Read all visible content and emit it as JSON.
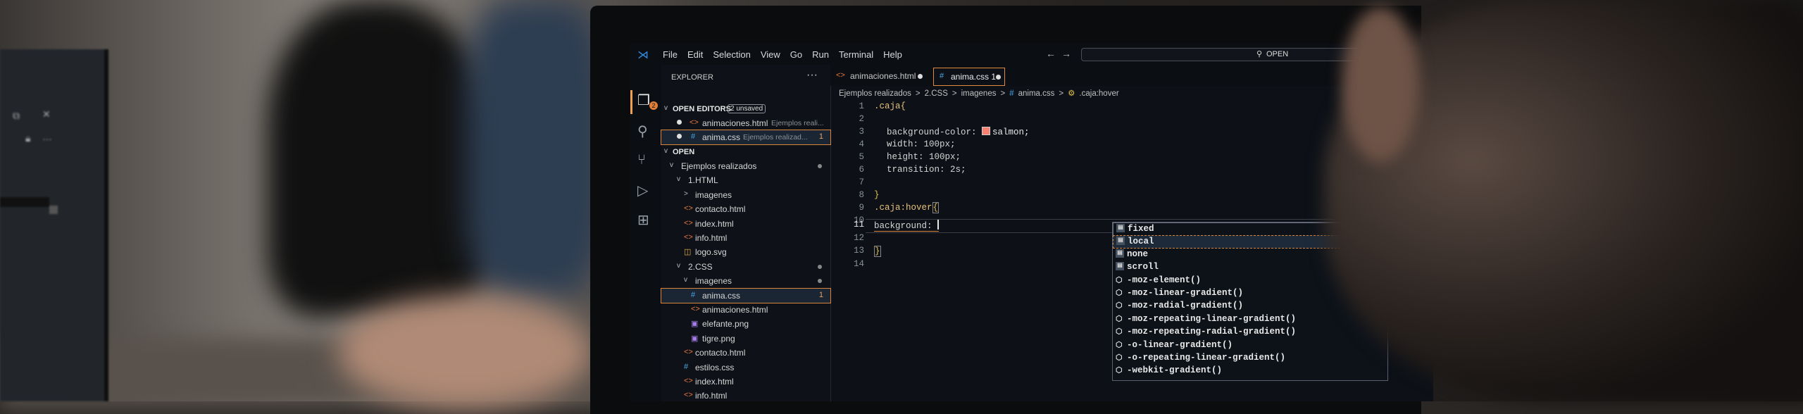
{
  "menu": [
    "File",
    "Edit",
    "Selection",
    "View",
    "Go",
    "Run",
    "Terminal",
    "Help"
  ],
  "search": {
    "text": "OPEN"
  },
  "activity_badge": "2",
  "explorer": {
    "title": "EXPLORER",
    "open_editors_label": "OPEN EDITORS",
    "unsaved_badge": "2 unsaved",
    "open_editors": [
      {
        "name": "animaciones.html",
        "desc": "Ejemplos reali...",
        "icon": "<>",
        "kind": "html"
      },
      {
        "name": "anima.css",
        "desc": "Ejemplos realizad...",
        "icon": "#",
        "kind": "css",
        "problems": "1"
      }
    ],
    "open_label": "OPEN",
    "tree": [
      {
        "name": "Ejemplos realizados",
        "icon": "v",
        "kind": "folder",
        "indent": 0
      },
      {
        "name": "1.HTML",
        "icon": "v",
        "kind": "folder",
        "indent": 1
      },
      {
        "name": "imagenes",
        "icon": ">",
        "kind": "folder",
        "indent": 2
      },
      {
        "name": "contacto.html",
        "icon": "<>",
        "kind": "html",
        "indent": 2
      },
      {
        "name": "index.html",
        "icon": "<>",
        "kind": "html",
        "indent": 2
      },
      {
        "name": "info.html",
        "icon": "<>",
        "kind": "html",
        "indent": 2
      },
      {
        "name": "logo.svg",
        "icon": "◫",
        "kind": "svg",
        "indent": 2
      },
      {
        "name": "2.CSS",
        "icon": "v",
        "kind": "folder",
        "indent": 1
      },
      {
        "name": "imagenes",
        "icon": "v",
        "kind": "folder",
        "indent": 2
      },
      {
        "name": "anima.css",
        "icon": "#",
        "kind": "css",
        "indent": 3,
        "problems": "1"
      },
      {
        "name": "animaciones.html",
        "icon": "<>",
        "kind": "html",
        "indent": 3
      },
      {
        "name": "elefante.png",
        "icon": "▣",
        "kind": "png",
        "indent": 3
      },
      {
        "name": "tigre.png",
        "icon": "▣",
        "kind": "png",
        "indent": 3
      },
      {
        "name": "contacto.html",
        "icon": "<>",
        "kind": "html",
        "indent": 2
      },
      {
        "name": "estilos.css",
        "icon": "#",
        "kind": "css",
        "indent": 2
      },
      {
        "name": "index.html",
        "icon": "<>",
        "kind": "html",
        "indent": 2
      },
      {
        "name": "info.html",
        "icon": "<>",
        "kind": "html",
        "indent": 2
      }
    ]
  },
  "tabs": [
    {
      "name": "animaciones.html",
      "icon": "<>"
    },
    {
      "name": "anima.css 1",
      "icon": "#"
    }
  ],
  "breadcrumb": [
    "Ejemplos realizados",
    ">",
    "2.CSS",
    ">",
    "imagenes",
    ">",
    "#",
    "anima.css",
    ">",
    "⚙",
    ".caja:hover"
  ],
  "code": {
    "line_numbers": [
      "1",
      "2",
      "3",
      "4",
      "5",
      "6",
      "7",
      "8",
      "9",
      "10",
      "11",
      "12",
      "13",
      "14"
    ],
    "l1": ".caja{",
    "l3_prop": "background-color:",
    "l3_val": "salmon;",
    "l4": "width: 100px;",
    "l5": "height: 100px;",
    "l6": "transition: 2s;",
    "l8": "}",
    "l9": ".caja:hover",
    "l9_brace": "{",
    "l11": "background: ",
    "l13": "}",
    "swatch_color": "#fa8072"
  },
  "suggestions": [
    {
      "label": "fixed",
      "icon": "kw"
    },
    {
      "label": "local",
      "icon": "kw"
    },
    {
      "label": "none",
      "icon": "kw"
    },
    {
      "label": "scroll",
      "icon": "kw"
    },
    {
      "label": "-moz-element()",
      "icon": "fn"
    },
    {
      "label": "-moz-linear-gradient()",
      "icon": "fn"
    },
    {
      "label": "-moz-radial-gradient()",
      "icon": "fn"
    },
    {
      "label": "-moz-repeating-linear-gradient()",
      "icon": "fn"
    },
    {
      "label": "-moz-repeating-radial-gradient()",
      "icon": "fn"
    },
    {
      "label": "-o-linear-gradient()",
      "icon": "fn"
    },
    {
      "label": "-o-repeating-linear-gradient()",
      "icon": "fn"
    },
    {
      "label": "-webkit-gradient()",
      "icon": "fn"
    }
  ],
  "colors": {
    "accent": "#e28a3c",
    "vscode_blue": "#2f8de3",
    "html_icon": "#e8773c",
    "css_icon": "#48a8e6"
  }
}
